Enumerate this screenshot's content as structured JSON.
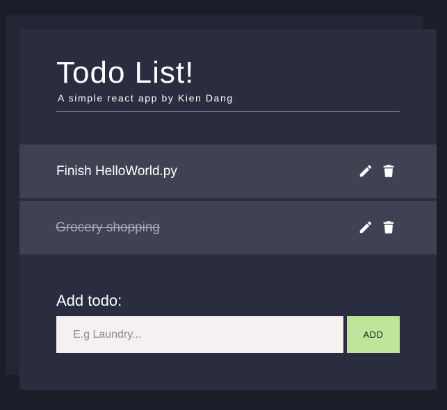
{
  "header": {
    "title": "Todo List!",
    "subtitle": "A simple react app by Kien Dang"
  },
  "todos": [
    {
      "text": "Finish HelloWorld.py",
      "completed": false,
      "edit_icon": "pencil-icon",
      "delete_icon": "trash-icon"
    },
    {
      "text": "Grocery shopping",
      "completed": true,
      "edit_icon": "pencil-icon",
      "delete_icon": "trash-icon"
    }
  ],
  "add_form": {
    "label": "Add todo:",
    "value": "",
    "placeholder": "E.g Laundry...",
    "button_label": "ADD"
  },
  "colors": {
    "background": "#1b1e29",
    "card": "#2a2d3f",
    "todo_row": "#3f4253",
    "input_bg": "#f6f0f0",
    "add_button": "#bde69a"
  }
}
